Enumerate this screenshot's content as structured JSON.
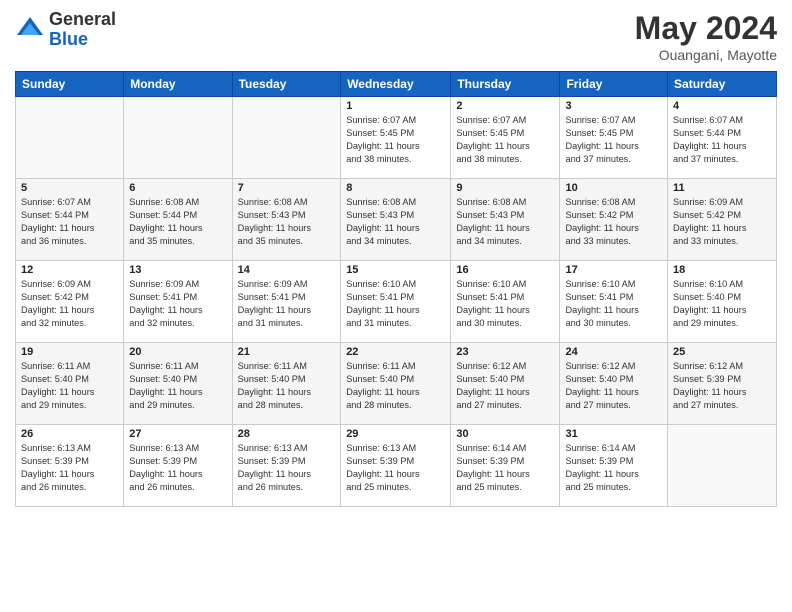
{
  "header": {
    "logo_general": "General",
    "logo_blue": "Blue",
    "month_title": "May 2024",
    "location": "Ouangani, Mayotte"
  },
  "days_of_week": [
    "Sunday",
    "Monday",
    "Tuesday",
    "Wednesday",
    "Thursday",
    "Friday",
    "Saturday"
  ],
  "weeks": [
    [
      {
        "num": "",
        "info": ""
      },
      {
        "num": "",
        "info": ""
      },
      {
        "num": "",
        "info": ""
      },
      {
        "num": "1",
        "info": "Sunrise: 6:07 AM\nSunset: 5:45 PM\nDaylight: 11 hours\nand 38 minutes."
      },
      {
        "num": "2",
        "info": "Sunrise: 6:07 AM\nSunset: 5:45 PM\nDaylight: 11 hours\nand 38 minutes."
      },
      {
        "num": "3",
        "info": "Sunrise: 6:07 AM\nSunset: 5:45 PM\nDaylight: 11 hours\nand 37 minutes."
      },
      {
        "num": "4",
        "info": "Sunrise: 6:07 AM\nSunset: 5:44 PM\nDaylight: 11 hours\nand 37 minutes."
      }
    ],
    [
      {
        "num": "5",
        "info": "Sunrise: 6:07 AM\nSunset: 5:44 PM\nDaylight: 11 hours\nand 36 minutes."
      },
      {
        "num": "6",
        "info": "Sunrise: 6:08 AM\nSunset: 5:44 PM\nDaylight: 11 hours\nand 35 minutes."
      },
      {
        "num": "7",
        "info": "Sunrise: 6:08 AM\nSunset: 5:43 PM\nDaylight: 11 hours\nand 35 minutes."
      },
      {
        "num": "8",
        "info": "Sunrise: 6:08 AM\nSunset: 5:43 PM\nDaylight: 11 hours\nand 34 minutes."
      },
      {
        "num": "9",
        "info": "Sunrise: 6:08 AM\nSunset: 5:43 PM\nDaylight: 11 hours\nand 34 minutes."
      },
      {
        "num": "10",
        "info": "Sunrise: 6:08 AM\nSunset: 5:42 PM\nDaylight: 11 hours\nand 33 minutes."
      },
      {
        "num": "11",
        "info": "Sunrise: 6:09 AM\nSunset: 5:42 PM\nDaylight: 11 hours\nand 33 minutes."
      }
    ],
    [
      {
        "num": "12",
        "info": "Sunrise: 6:09 AM\nSunset: 5:42 PM\nDaylight: 11 hours\nand 32 minutes."
      },
      {
        "num": "13",
        "info": "Sunrise: 6:09 AM\nSunset: 5:41 PM\nDaylight: 11 hours\nand 32 minutes."
      },
      {
        "num": "14",
        "info": "Sunrise: 6:09 AM\nSunset: 5:41 PM\nDaylight: 11 hours\nand 31 minutes."
      },
      {
        "num": "15",
        "info": "Sunrise: 6:10 AM\nSunset: 5:41 PM\nDaylight: 11 hours\nand 31 minutes."
      },
      {
        "num": "16",
        "info": "Sunrise: 6:10 AM\nSunset: 5:41 PM\nDaylight: 11 hours\nand 30 minutes."
      },
      {
        "num": "17",
        "info": "Sunrise: 6:10 AM\nSunset: 5:41 PM\nDaylight: 11 hours\nand 30 minutes."
      },
      {
        "num": "18",
        "info": "Sunrise: 6:10 AM\nSunset: 5:40 PM\nDaylight: 11 hours\nand 29 minutes."
      }
    ],
    [
      {
        "num": "19",
        "info": "Sunrise: 6:11 AM\nSunset: 5:40 PM\nDaylight: 11 hours\nand 29 minutes."
      },
      {
        "num": "20",
        "info": "Sunrise: 6:11 AM\nSunset: 5:40 PM\nDaylight: 11 hours\nand 29 minutes."
      },
      {
        "num": "21",
        "info": "Sunrise: 6:11 AM\nSunset: 5:40 PM\nDaylight: 11 hours\nand 28 minutes."
      },
      {
        "num": "22",
        "info": "Sunrise: 6:11 AM\nSunset: 5:40 PM\nDaylight: 11 hours\nand 28 minutes."
      },
      {
        "num": "23",
        "info": "Sunrise: 6:12 AM\nSunset: 5:40 PM\nDaylight: 11 hours\nand 27 minutes."
      },
      {
        "num": "24",
        "info": "Sunrise: 6:12 AM\nSunset: 5:40 PM\nDaylight: 11 hours\nand 27 minutes."
      },
      {
        "num": "25",
        "info": "Sunrise: 6:12 AM\nSunset: 5:39 PM\nDaylight: 11 hours\nand 27 minutes."
      }
    ],
    [
      {
        "num": "26",
        "info": "Sunrise: 6:13 AM\nSunset: 5:39 PM\nDaylight: 11 hours\nand 26 minutes."
      },
      {
        "num": "27",
        "info": "Sunrise: 6:13 AM\nSunset: 5:39 PM\nDaylight: 11 hours\nand 26 minutes."
      },
      {
        "num": "28",
        "info": "Sunrise: 6:13 AM\nSunset: 5:39 PM\nDaylight: 11 hours\nand 26 minutes."
      },
      {
        "num": "29",
        "info": "Sunrise: 6:13 AM\nSunset: 5:39 PM\nDaylight: 11 hours\nand 25 minutes."
      },
      {
        "num": "30",
        "info": "Sunrise: 6:14 AM\nSunset: 5:39 PM\nDaylight: 11 hours\nand 25 minutes."
      },
      {
        "num": "31",
        "info": "Sunrise: 6:14 AM\nSunset: 5:39 PM\nDaylight: 11 hours\nand 25 minutes."
      },
      {
        "num": "",
        "info": ""
      }
    ]
  ]
}
